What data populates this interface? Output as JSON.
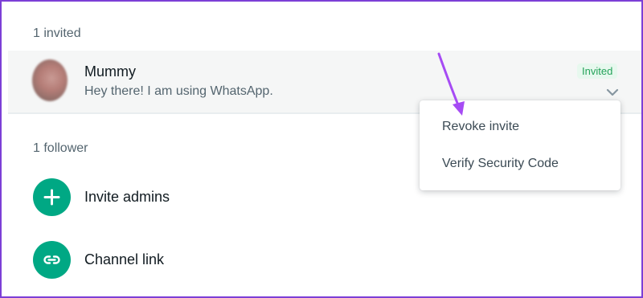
{
  "invited_section": {
    "label": "1 invited",
    "contact": {
      "name": "Mummy",
      "status": "Hey there! I am using WhatsApp.",
      "badge": "Invited",
      "badge_color": "#25a35a"
    }
  },
  "context_menu": {
    "items": [
      {
        "label": "Revoke invite"
      },
      {
        "label": "Verify Security Code"
      }
    ]
  },
  "followers_section": {
    "label": "1 follower"
  },
  "actions": [
    {
      "label": "Invite admins",
      "icon": "plus-icon"
    },
    {
      "label": "Channel link",
      "icon": "link-icon"
    }
  ],
  "colors": {
    "accent": "#00a884",
    "annotation_arrow": "#a64bf4",
    "frame_border": "#7c3fd6"
  }
}
